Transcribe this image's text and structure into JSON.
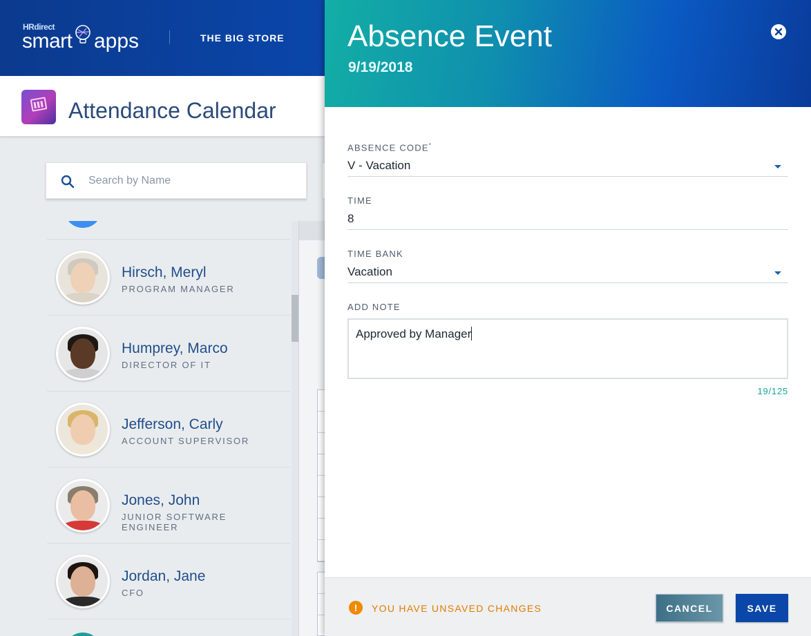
{
  "header": {
    "logo_hr": "HRdirect",
    "logo_smart": "smart",
    "logo_apps": "apps",
    "store_name": "THE BIG STORE"
  },
  "app": {
    "title": "Attendance Calendar",
    "icon": "calendar-app-icon"
  },
  "search": {
    "placeholder": "Search by Name",
    "value": ""
  },
  "employees": [
    {
      "name": "Hirsch, Meryl",
      "role": "PROGRAM MANAGER"
    },
    {
      "name": "Humprey, Marco",
      "role": "DIRECTOR OF IT"
    },
    {
      "name": "Jefferson, Carly",
      "role": "ACCOUNT SUPERVISOR"
    },
    {
      "name": "Jones, John",
      "role": "JUNIOR SOFTWARE ENGINEER"
    },
    {
      "name": "Jordan, Jane",
      "role": "CFO"
    }
  ],
  "drawer": {
    "title": "Absence Event",
    "date": "9/19/2018",
    "close_icon": "close-icon",
    "fields": {
      "absence_code": {
        "label": "ABSENCE CODE",
        "required_mark": "*",
        "value": "V - Vacation"
      },
      "time": {
        "label": "TIME",
        "value": "8"
      },
      "time_bank": {
        "label": "TIME BANK",
        "value": "Vacation"
      },
      "note": {
        "label": "ADD NOTE",
        "value": "Approved by Manager",
        "count": "19/125"
      }
    },
    "footer": {
      "warning_icon": "!",
      "warning_text": "YOU HAVE UNSAVED CHANGES",
      "cancel_label": "CANCEL",
      "save_label": "SAVE"
    }
  },
  "colors": {
    "header_blue": "#0a4cb8",
    "drawer_teal": "#13aea5",
    "link_blue": "#1f4e8a",
    "warning_orange": "#e07c00",
    "save_blue": "#0b47a8",
    "count_teal": "#16a398"
  }
}
